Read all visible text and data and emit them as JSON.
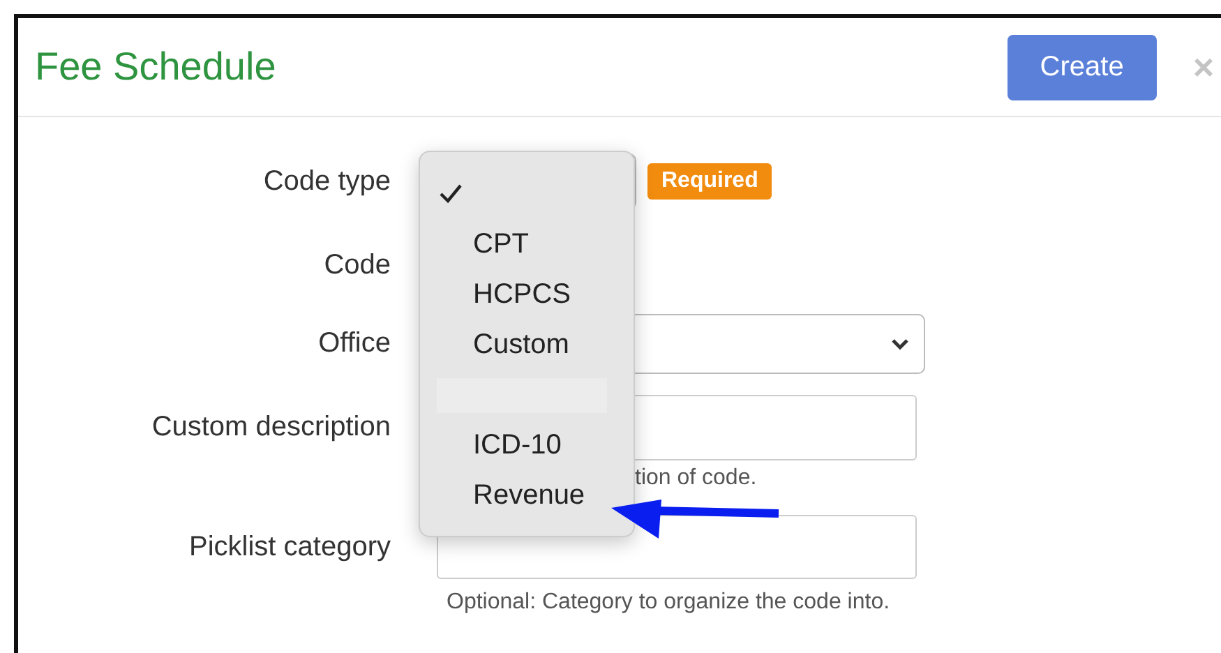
{
  "dialog": {
    "title": "Fee Schedule",
    "create_button": "Create",
    "close_glyph": "×"
  },
  "form": {
    "code_type": {
      "label": "Code type",
      "badge": "Required"
    },
    "code": {
      "label": "Code"
    },
    "office": {
      "label": "Office"
    },
    "custom_description": {
      "label": "Custom description",
      "hint": "tion of code."
    },
    "picklist_category": {
      "label": "Picklist category",
      "hint": "Optional: Category to organize the code into."
    }
  },
  "code_type_menu": [
    {
      "kind": "option",
      "selected": true
    },
    {
      "kind": "option",
      "label": "CPT",
      "selected": false
    },
    {
      "kind": "option",
      "label": "HCPCS",
      "selected": false
    },
    {
      "kind": "option",
      "label": "Custom",
      "selected": false
    },
    {
      "kind": "separator"
    },
    {
      "kind": "option",
      "label": "ICD-10",
      "selected": false
    },
    {
      "kind": "option",
      "label": "Revenue",
      "selected": false
    }
  ]
}
